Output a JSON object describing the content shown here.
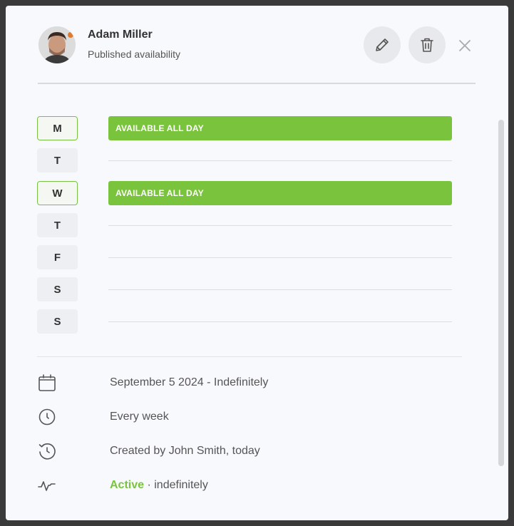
{
  "user": {
    "name": "Adam Miller",
    "subtitle": "Published availability"
  },
  "icons": {
    "edit": "pencil-icon",
    "delete": "trash-icon",
    "close": "close-icon"
  },
  "days": [
    {
      "letter": "M",
      "available": true,
      "label": "AVAILABLE ALL DAY"
    },
    {
      "letter": "T",
      "available": false,
      "label": ""
    },
    {
      "letter": "W",
      "available": true,
      "label": "AVAILABLE ALL DAY"
    },
    {
      "letter": "T",
      "available": false,
      "label": ""
    },
    {
      "letter": "F",
      "available": false,
      "label": ""
    },
    {
      "letter": "S",
      "available": false,
      "label": ""
    },
    {
      "letter": "S",
      "available": false,
      "label": ""
    }
  ],
  "info": {
    "date_range": "September 5 2024 - Indefinitely",
    "recurrence": "Every week",
    "created": "Created by John Smith, today",
    "status": "Active",
    "status_suffix": " · indefinitely"
  },
  "colors": {
    "accent_green": "#79c43c",
    "background": "#f8f9fc"
  }
}
